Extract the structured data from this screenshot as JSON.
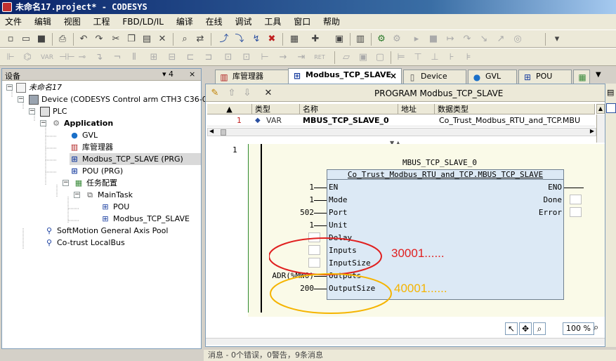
{
  "window": {
    "title": "未命名17.project* - CODESYS"
  },
  "menu": [
    "文件",
    "编辑",
    "视图",
    "工程",
    "FBD/LD/IL",
    "编译",
    "在线",
    "调试",
    "工具",
    "窗口",
    "帮助"
  ],
  "devices_panel": {
    "title": "设备",
    "controls": [
      "▾ 4",
      "×"
    ],
    "tree": {
      "project": "未命名17",
      "device": "Device (CODESYS Control arm CTH3 C36-000S",
      "plc": "PLC",
      "application": "Application",
      "gvl": "GVL",
      "library_manager": "库管理器",
      "modbus_prg": "Modbus_TCP_SLAVE (PRG)",
      "pou_prg": "POU (PRG)",
      "task_config": "任务配置",
      "main_task": "MainTask",
      "task_pou": "POU",
      "task_modbus": "Modbus_TCP_SLAVE",
      "softmotion": "SoftMotion General Axis Pool",
      "localbus": "Co-trust LocalBus"
    }
  },
  "tabs": [
    {
      "label": "库管理器",
      "icon": "library-icon"
    },
    {
      "label": "Modbus_TCP_SLAVE",
      "icon": "prg-icon",
      "active": true,
      "close": "×"
    },
    {
      "label": "Device",
      "icon": "device-icon"
    },
    {
      "label": "GVL",
      "icon": "globe-icon"
    },
    {
      "label": "POU",
      "icon": "prg-icon"
    }
  ],
  "editor": {
    "header": "PROGRAM Modbus_TCP_SLAVE",
    "columns": [
      "类型",
      "名称",
      "地址",
      "数据类型"
    ],
    "row": {
      "num": "1",
      "kind": "VAR",
      "name": "MBUS_TCP_SLAVE_0",
      "address": "",
      "datatype": "Co_Trust_Modbus_RTU_and_TCP.MBU"
    },
    "network_number": "1",
    "instance_name": "MBUS_TCP_SLAVE_0",
    "fb_type": "Co_Trust_Modbus_RTU_and_TCP.MBUS_TCP_SLAVE",
    "inputs": [
      {
        "name": "EN",
        "value": "1"
      },
      {
        "name": "Mode",
        "value": "1"
      },
      {
        "name": "Port",
        "value": "502"
      },
      {
        "name": "Unit",
        "value": "1"
      },
      {
        "name": "Delay",
        "value": ""
      },
      {
        "name": "Inputs",
        "value": ""
      },
      {
        "name": "InputSize",
        "value": ""
      },
      {
        "name": "Outputs",
        "value": "ADR(%MW0)"
      },
      {
        "name": "OutputSize",
        "value": "200"
      }
    ],
    "outputs": [
      "ENO",
      "Done",
      "Error"
    ],
    "annotation_inputs": "30001......",
    "annotation_outputs": "40001......",
    "zoom": "100 %"
  },
  "statusbar": "消息 - 0个错误，0警告，9条消息",
  "colors": {
    "annotation_red": "#e02020",
    "annotation_orange": "#f5b400",
    "fb_fill": "#dce9f5"
  }
}
